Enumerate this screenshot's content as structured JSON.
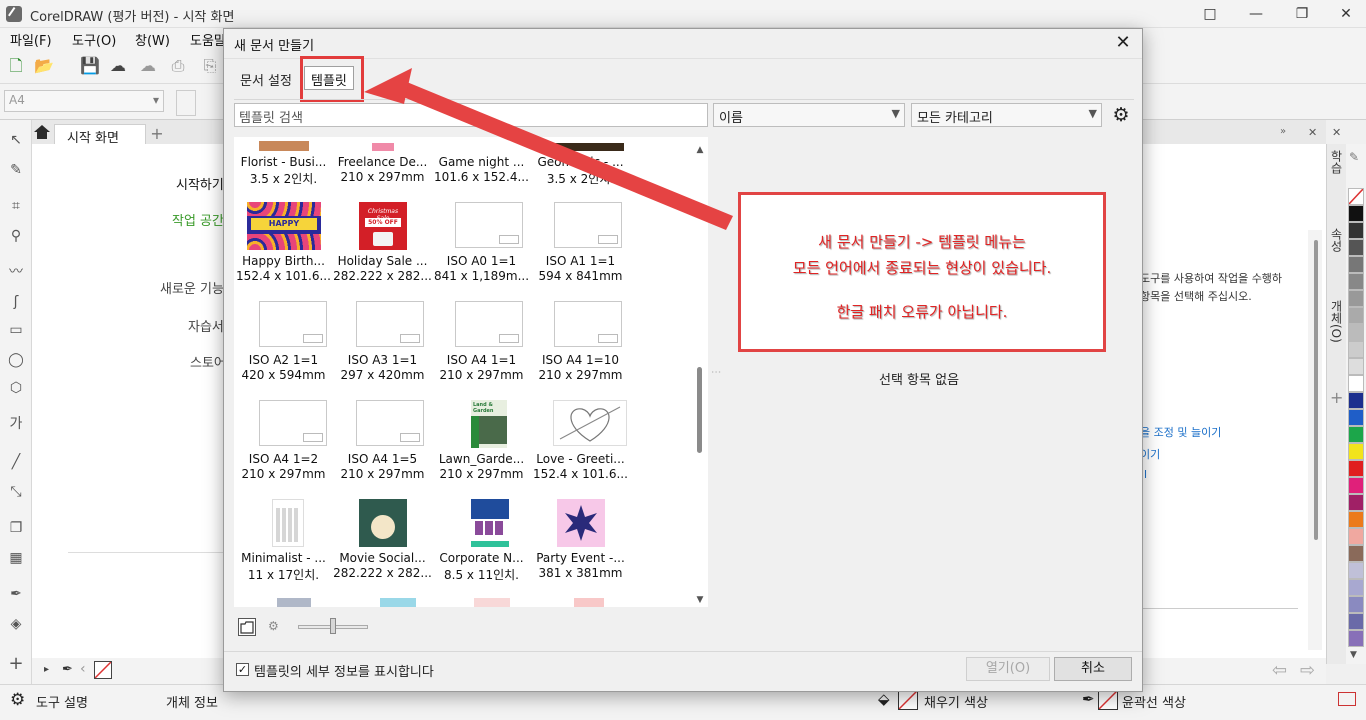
{
  "app": {
    "title": "CorelDRAW (평가 버전) - 시작 화면",
    "window_controls": [
      "□",
      "—",
      "❐",
      "✕"
    ]
  },
  "menu": [
    "파일(F)",
    "도구(O)",
    "창(W)",
    "도움말"
  ],
  "toolbar": {
    "page_size": "A4"
  },
  "tabs": {
    "start": "시작 화면",
    "add": "+"
  },
  "start_page": {
    "items": [
      "시작하기",
      "작업 공간",
      "새로운 기능",
      "자습서",
      "스토어"
    ],
    "accent_color": "#3a9a2a"
  },
  "docker": {
    "tabs": [
      "학습",
      "속성",
      "개체(O)"
    ],
    "text_lines": [
      "도구를 사용하여 작업을 수행하",
      "항목을 선택해 주십시오."
    ],
    "links": [
      "을 조정 및 늘이기",
      "이기",
      "l"
    ]
  },
  "status": {
    "tool_hint": "도구 설명",
    "object_info": "개체 정보",
    "fill_color": "채우기 색상",
    "outline_color": "윤곽선 색상"
  },
  "dialog": {
    "title": "새 문서 만들기",
    "close": "✕",
    "tabs": {
      "doc_settings": "문서 설정",
      "template": "템플릿"
    },
    "search_placeholder": "템플릿 검색",
    "sort_by": "이름",
    "category": "모든 카테고리",
    "no_selection": "선택 항목 없음",
    "details_label": "템플릿의 세부 정보를 표시합니다",
    "details_checked": true,
    "open_label": "열기(O)",
    "cancel_label": "취소",
    "templates": [
      {
        "name": "Florist - Busi...",
        "size": "3.5 x 2인치."
      },
      {
        "name": "Freelance De...",
        "size": "210 x 297mm"
      },
      {
        "name": "Game night ...",
        "size": "101.6 x 152.4..."
      },
      {
        "name": "Geometric - ...",
        "size": "3.5 x 2인치."
      },
      {
        "name": "Happy Birth...",
        "size": "152.4 x 101.6..."
      },
      {
        "name": "Holiday Sale ...",
        "size": "282.222 x 282..."
      },
      {
        "name": "ISO A0 1=1",
        "size": "841 x 1,189m..."
      },
      {
        "name": "ISO A1 1=1",
        "size": "594 x 841mm"
      },
      {
        "name": "ISO A2 1=1",
        "size": "420 x 594mm"
      },
      {
        "name": "ISO A3 1=1",
        "size": "297 x 420mm"
      },
      {
        "name": "ISO A4 1=1",
        "size": "210 x 297mm"
      },
      {
        "name": "ISO A4 1=10",
        "size": "210 x 297mm"
      },
      {
        "name": "ISO A4 1=2",
        "size": "210 x 297mm"
      },
      {
        "name": "ISO A4 1=5",
        "size": "210 x 297mm"
      },
      {
        "name": "Lawn_Garde...",
        "size": "210 x 297mm"
      },
      {
        "name": "Love - Greeti...",
        "size": "152.4 x 101.6..."
      },
      {
        "name": "Minimalist - ...",
        "size": "11 x 17인치."
      },
      {
        "name": "Movie Social...",
        "size": "282.222 x 282..."
      },
      {
        "name": "Corporate N...",
        "size": "8.5 x 11인치."
      },
      {
        "name": "Party Event -...",
        "size": "381 x 381mm"
      }
    ],
    "thumb_texts": {
      "birthday": "HAPPY BIRTHDAY",
      "sale": "Christmas Sale",
      "sale_off": "50% OFF",
      "lawn": "Land & Garden"
    }
  },
  "annotation": {
    "lines": [
      "새 문서 만들기 -> 템플릿 메뉴는",
      "모든 언어에서 종료되는 현상이 있습니다.",
      "한글 패치 오류가 아닙니다."
    ],
    "color": "#e02424"
  }
}
